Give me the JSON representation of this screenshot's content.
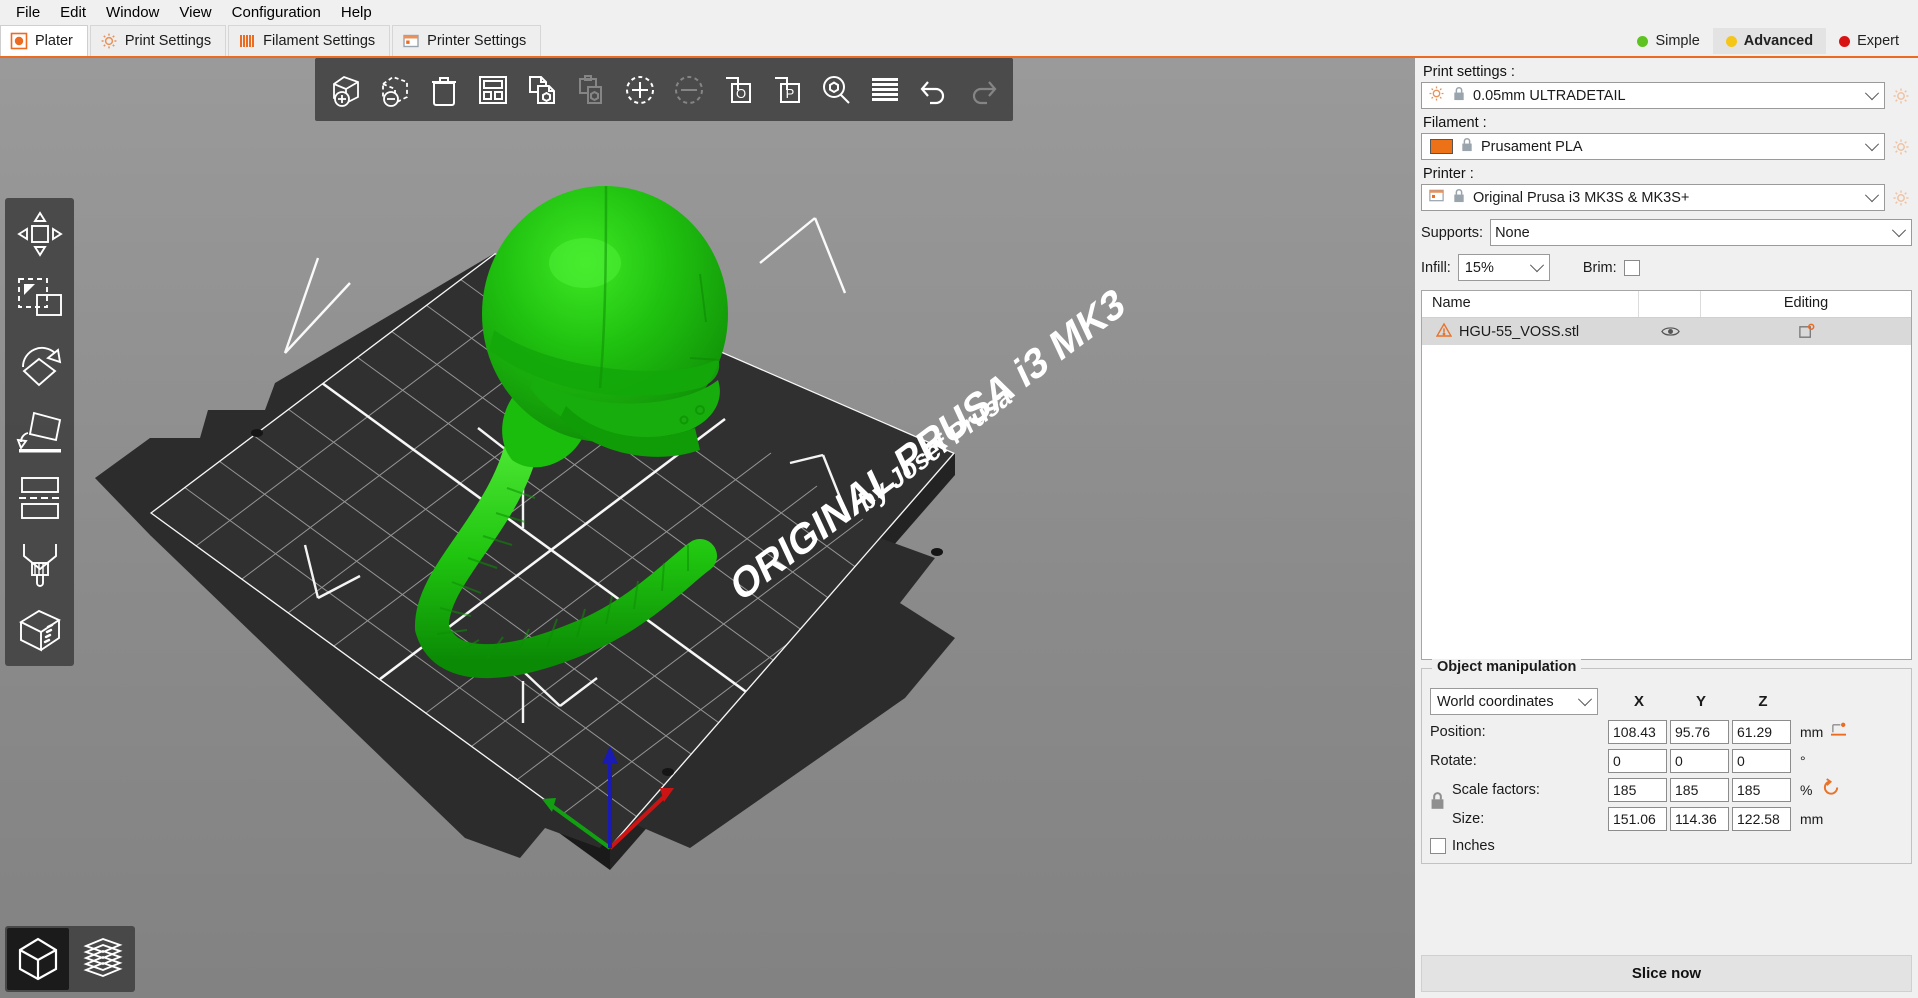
{
  "window": {
    "title": "PrusaSlicer"
  },
  "menubar": {
    "items": [
      {
        "label": "File"
      },
      {
        "label": "Edit"
      },
      {
        "label": "Window"
      },
      {
        "label": "View"
      },
      {
        "label": "Configuration"
      },
      {
        "label": "Help"
      }
    ]
  },
  "tabs": [
    {
      "label": "Plater",
      "icon": "plater-icon",
      "active": true
    },
    {
      "label": "Print Settings",
      "icon": "print-settings-icon",
      "active": false
    },
    {
      "label": "Filament Settings",
      "icon": "filament-settings-icon",
      "active": false
    },
    {
      "label": "Printer Settings",
      "icon": "printer-settings-icon",
      "active": false
    }
  ],
  "modes": [
    {
      "label": "Simple",
      "color": "#5ec221",
      "selected": false
    },
    {
      "label": "Advanced",
      "color": "#f5c518",
      "selected": true
    },
    {
      "label": "Expert",
      "color": "#d81313",
      "selected": false
    }
  ],
  "top_toolbar": [
    {
      "name": "add-icon",
      "enabled": true
    },
    {
      "name": "delete-icon",
      "enabled": true
    },
    {
      "name": "delete-all-icon",
      "enabled": true
    },
    {
      "name": "arrange-icon",
      "enabled": true
    },
    {
      "name": "copy-icon",
      "enabled": true
    },
    {
      "name": "paste-icon",
      "enabled": false
    },
    {
      "name": "add-instance-icon",
      "enabled": true
    },
    {
      "name": "remove-instance-icon",
      "enabled": false
    },
    {
      "name": "split-to-objects-icon",
      "enabled": true
    },
    {
      "name": "split-to-parts-icon",
      "enabled": true
    },
    {
      "name": "search-icon",
      "enabled": true
    },
    {
      "name": "variable-layer-height-icon",
      "enabled": true
    },
    {
      "name": "undo-icon",
      "enabled": true
    },
    {
      "name": "redo-icon",
      "enabled": false
    }
  ],
  "left_toolbar": [
    {
      "name": "move-gizmo-icon"
    },
    {
      "name": "scale-gizmo-icon"
    },
    {
      "name": "rotate-gizmo-icon"
    },
    {
      "name": "place-on-face-gizmo-icon"
    },
    {
      "name": "cut-gizmo-icon"
    },
    {
      "name": "paint-support-gizmo-icon"
    },
    {
      "name": "seam-painting-gizmo-icon"
    }
  ],
  "view_toggle": [
    {
      "name": "editor-view-icon",
      "active": true
    },
    {
      "name": "preview-view-icon",
      "active": false
    }
  ],
  "viewport": {
    "bed_text_line1": "ORIGINAL PRUSA i3 MK3",
    "bed_text_line2": "by Josef Prusa",
    "model_color": "#22c312",
    "background_color": "#8c8c8c",
    "bed_color": "#2d2d2d",
    "axes": [
      {
        "name": "x-axis",
        "color": "#cc1414"
      },
      {
        "name": "y-axis",
        "color": "#12a012"
      },
      {
        "name": "z-axis",
        "color": "#1a1ab4"
      }
    ]
  },
  "sidebar": {
    "print_settings": {
      "label": "Print settings :",
      "value": "0.05mm ULTRADETAIL"
    },
    "filament": {
      "label": "Filament :",
      "value": "Prusament PLA",
      "swatch_color": "#ed7117"
    },
    "printer": {
      "label": "Printer :",
      "value": "Original Prusa i3 MK3S & MK3S+"
    },
    "supports": {
      "label": "Supports:",
      "value": "None"
    },
    "infill": {
      "label": "Infill:",
      "value": "15%"
    },
    "brim": {
      "label": "Brim:",
      "checked": false
    },
    "object_list": {
      "columns": [
        "Name",
        "",
        "Editing"
      ],
      "rows": [
        {
          "name": "HGU-55_VOSS.stl",
          "warning": true,
          "eye": "eye-icon",
          "editing": "editing-icon",
          "selected": true
        }
      ]
    },
    "object_manipulation": {
      "title": "Object manipulation",
      "coordinate_system": "World coordinates",
      "axis_headers": [
        "X",
        "Y",
        "Z"
      ],
      "rows": [
        {
          "label": "Position:",
          "values": [
            "108.43",
            "95.76",
            "61.29"
          ],
          "unit": "mm"
        },
        {
          "label": "Rotate:",
          "values": [
            "0",
            "0",
            "0"
          ],
          "unit": "°"
        },
        {
          "label": "Scale factors:",
          "values": [
            "185",
            "185",
            "185"
          ],
          "unit": "%"
        },
        {
          "label": "Size:",
          "values": [
            "151.06",
            "114.36",
            "122.58"
          ],
          "unit": "mm"
        }
      ],
      "inches": {
        "label": "Inches",
        "checked": false
      },
      "uniform_scale_locked": true
    },
    "slice_button": {
      "label": "Slice now"
    }
  }
}
